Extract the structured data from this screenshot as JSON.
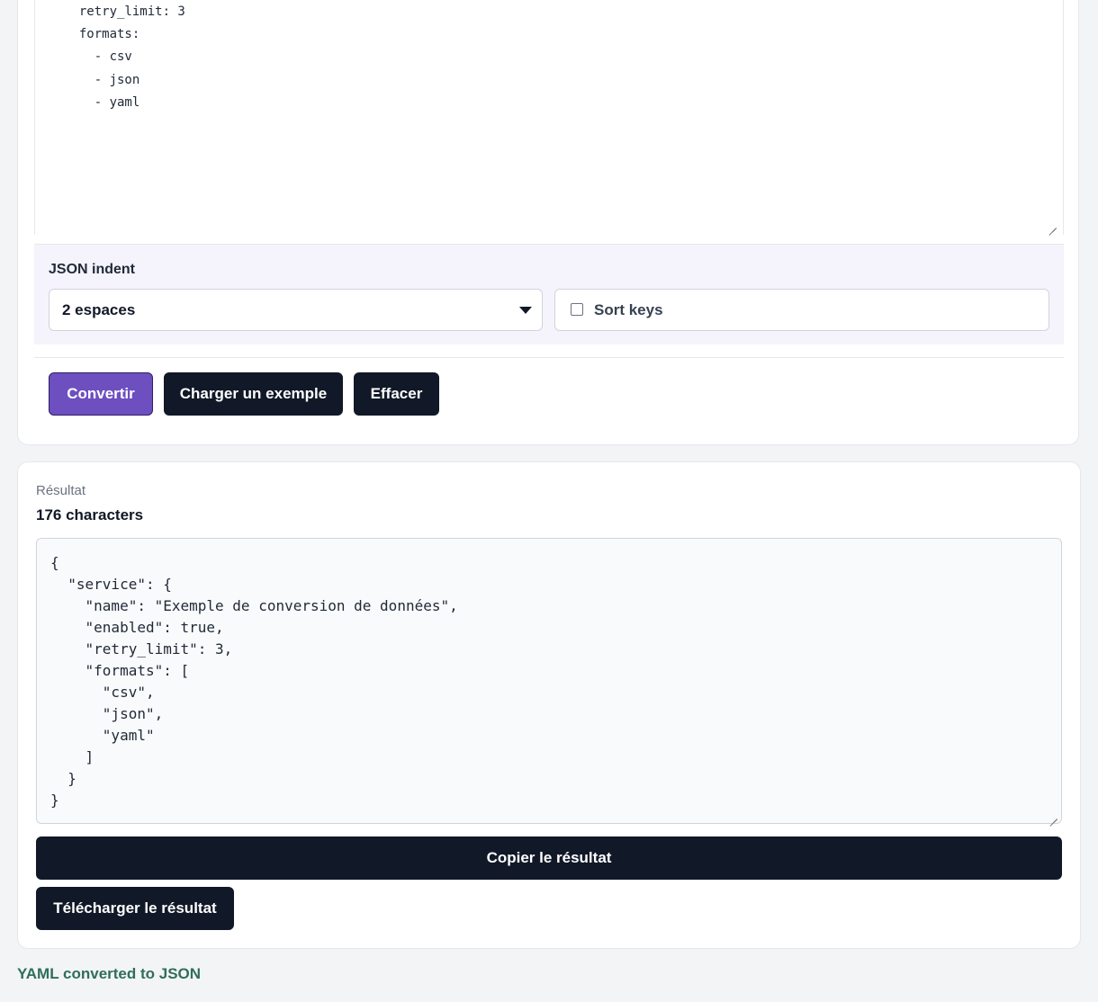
{
  "input": {
    "yaml_text": "  retry_limit: 3\n  formats:\n    - csv\n    - json\n    - yaml"
  },
  "options": {
    "indent_label": "JSON indent",
    "indent_selected": "2 espaces",
    "sort_keys_label": "Sort keys",
    "sort_keys_checked": false
  },
  "actions": {
    "convert_label": "Convertir",
    "load_example_label": "Charger un exemple",
    "clear_label": "Effacer"
  },
  "result": {
    "label": "Résultat",
    "count": "176 characters",
    "output_text": "{\n  \"service\": {\n    \"name\": \"Exemple de conversion de données\",\n    \"enabled\": true,\n    \"retry_limit\": 3,\n    \"formats\": [\n      \"csv\",\n      \"json\",\n      \"yaml\"\n    ]\n  }\n}",
    "copy_label": "Copier le résultat",
    "download_label": "Télécharger le résultat"
  },
  "status": {
    "message": "YAML converted to JSON",
    "color": "#2f6e5a"
  },
  "colors": {
    "accent": "#6d4fc0",
    "dark_button": "#111827",
    "options_bg": "#f5f3fb"
  }
}
